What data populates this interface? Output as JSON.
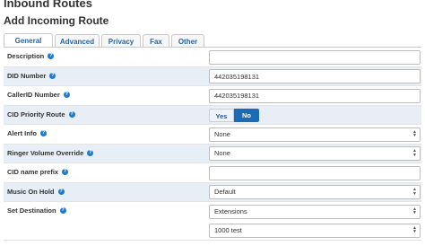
{
  "page_title": "Inbound Routes",
  "sub_title": "Add Incoming Route",
  "tabs": [
    {
      "label": "General",
      "active": true
    },
    {
      "label": "Advanced",
      "active": false
    },
    {
      "label": "Privacy",
      "active": false
    },
    {
      "label": "Fax",
      "active": false
    },
    {
      "label": "Other",
      "active": false
    }
  ],
  "form": {
    "description": {
      "label": "Description",
      "value": ""
    },
    "did_number": {
      "label": "DID Number",
      "value": "442035198131"
    },
    "callerid_number": {
      "label": "CallerID Number",
      "value": "442035198131"
    },
    "cid_priority_route": {
      "label": "CID Priority Route",
      "yes": "Yes",
      "no": "No",
      "selected": "No"
    },
    "alert_info": {
      "label": "Alert Info",
      "value": "None"
    },
    "ringer_volume_override": {
      "label": "Ringer Volume Override",
      "value": "None"
    },
    "cid_name_prefix": {
      "label": "CID name prefix",
      "value": ""
    },
    "music_on_hold": {
      "label": "Music On Hold",
      "value": "Default"
    },
    "set_destination": {
      "label": "Set Destination",
      "type_value": "Extensions",
      "target_value": "1000 test"
    }
  },
  "colors": {
    "accent": "#1b6cb5",
    "tab_text": "#2466a8",
    "row_shade": "#e8eef6",
    "help_icon": "#1b7ccf"
  }
}
